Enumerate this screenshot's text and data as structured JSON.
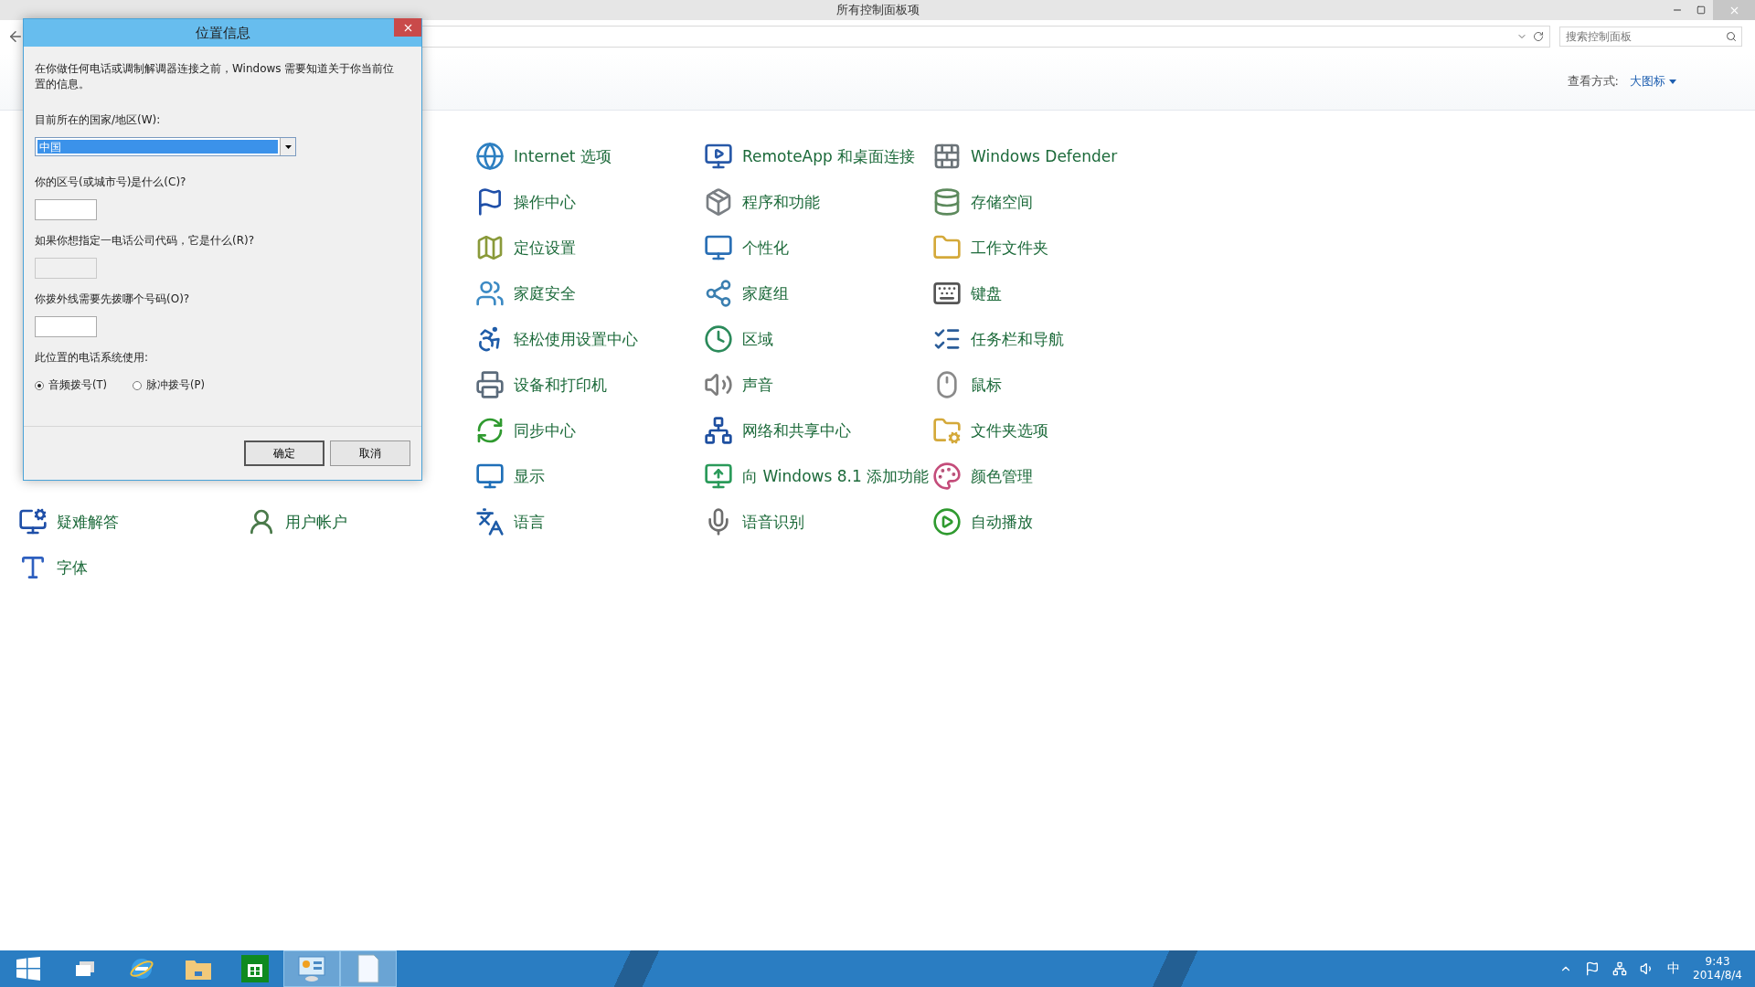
{
  "window": {
    "title": "所有控制面板项",
    "search": {
      "placeholder": "搜索控制面板"
    },
    "view_label": "查看方式:",
    "view_value": "大图标"
  },
  "items": [
    {
      "label": "Internet 选项"
    },
    {
      "label": "RemoteApp 和桌面连接"
    },
    {
      "label": "Windows Defender"
    },
    {
      "label": "操作中心"
    },
    {
      "label": "程序和功能"
    },
    {
      "label": "存储空间"
    },
    {
      "label": "定位设置"
    },
    {
      "label": "个性化"
    },
    {
      "label": "工作文件夹"
    },
    {
      "label": "家庭安全"
    },
    {
      "label": "家庭组"
    },
    {
      "label": "键盘"
    },
    {
      "label": "轻松使用设置中心"
    },
    {
      "label": "区域"
    },
    {
      "label": "任务栏和导航"
    },
    {
      "label": "设备和打印机"
    },
    {
      "label": "声音"
    },
    {
      "label": "鼠标"
    },
    {
      "label": "同步中心"
    },
    {
      "label": "网络和共享中心"
    },
    {
      "label": "文件夹选项"
    },
    {
      "label": "显示"
    },
    {
      "label": "向 Windows 8.1 添加功能"
    },
    {
      "label": "颜色管理"
    },
    {
      "label": "语言"
    },
    {
      "label": "语音识别"
    },
    {
      "label": "自动播放"
    }
  ],
  "left_items": [
    {
      "label": "疑难解答"
    },
    {
      "label": "用户帐户"
    },
    {
      "label": "字体"
    }
  ],
  "dialog": {
    "title": "位置信息",
    "intro": "在你做任何电话或调制解调器连接之前，Windows 需要知道关于你当前位置的信息。",
    "country_label": "目前所在的国家/地区(W):",
    "country_value": "中国",
    "fields": [
      {
        "label": "你的区号(或城市号)是什么(C)?",
        "disabled": false
      },
      {
        "label": "如果你想指定一电话公司代码，它是什么(R)?",
        "disabled": true
      },
      {
        "label": "你拨外线需要先拨哪个号码(O)?",
        "disabled": false
      }
    ],
    "dial_label": "此位置的电话系统使用:",
    "dial_options": [
      {
        "label": "音频拨号(T)",
        "selected": true
      },
      {
        "label": "脉冲拨号(P)",
        "selected": false
      }
    ],
    "buttons": [
      {
        "label": "确定",
        "default": true
      },
      {
        "label": "取消",
        "default": false
      }
    ]
  },
  "taskbar": {
    "apps": [
      {
        "active": false
      },
      {
        "active": false
      },
      {
        "active": false
      },
      {
        "active": false
      },
      {
        "active": false
      },
      {
        "active": true
      },
      {
        "active": true
      }
    ],
    "ime": "中",
    "time": "9:43",
    "date": "2014/8/4"
  }
}
